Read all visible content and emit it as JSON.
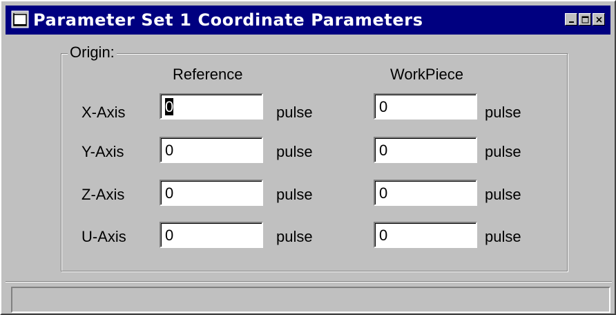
{
  "window": {
    "title": "Parameter Set 1 Coordinate Parameters"
  },
  "group": {
    "legend": "Origin:"
  },
  "columns": {
    "reference": "Reference",
    "workpiece": "WorkPiece"
  },
  "rows": [
    {
      "axis": "X-Axis",
      "reference_value": "0",
      "reference_unit": "pulse",
      "workpiece_value": "0",
      "workpiece_unit": "pulse"
    },
    {
      "axis": "Y-Axis",
      "reference_value": "0",
      "reference_unit": "pulse",
      "workpiece_value": "0",
      "workpiece_unit": "pulse"
    },
    {
      "axis": "Z-Axis",
      "reference_value": "0",
      "reference_unit": "pulse",
      "workpiece_value": "0",
      "workpiece_unit": "pulse"
    },
    {
      "axis": "U-Axis",
      "reference_value": "0",
      "reference_unit": "pulse",
      "workpiece_value": "0",
      "workpiece_unit": "pulse"
    }
  ],
  "status": {
    "text": ""
  },
  "colors": {
    "titlebar": "#000080",
    "face": "#c0c0c0"
  },
  "icons": {
    "app": "app-window-icon",
    "minimize": "minimize-icon",
    "maximize": "maximize-icon",
    "close": "close-icon"
  }
}
